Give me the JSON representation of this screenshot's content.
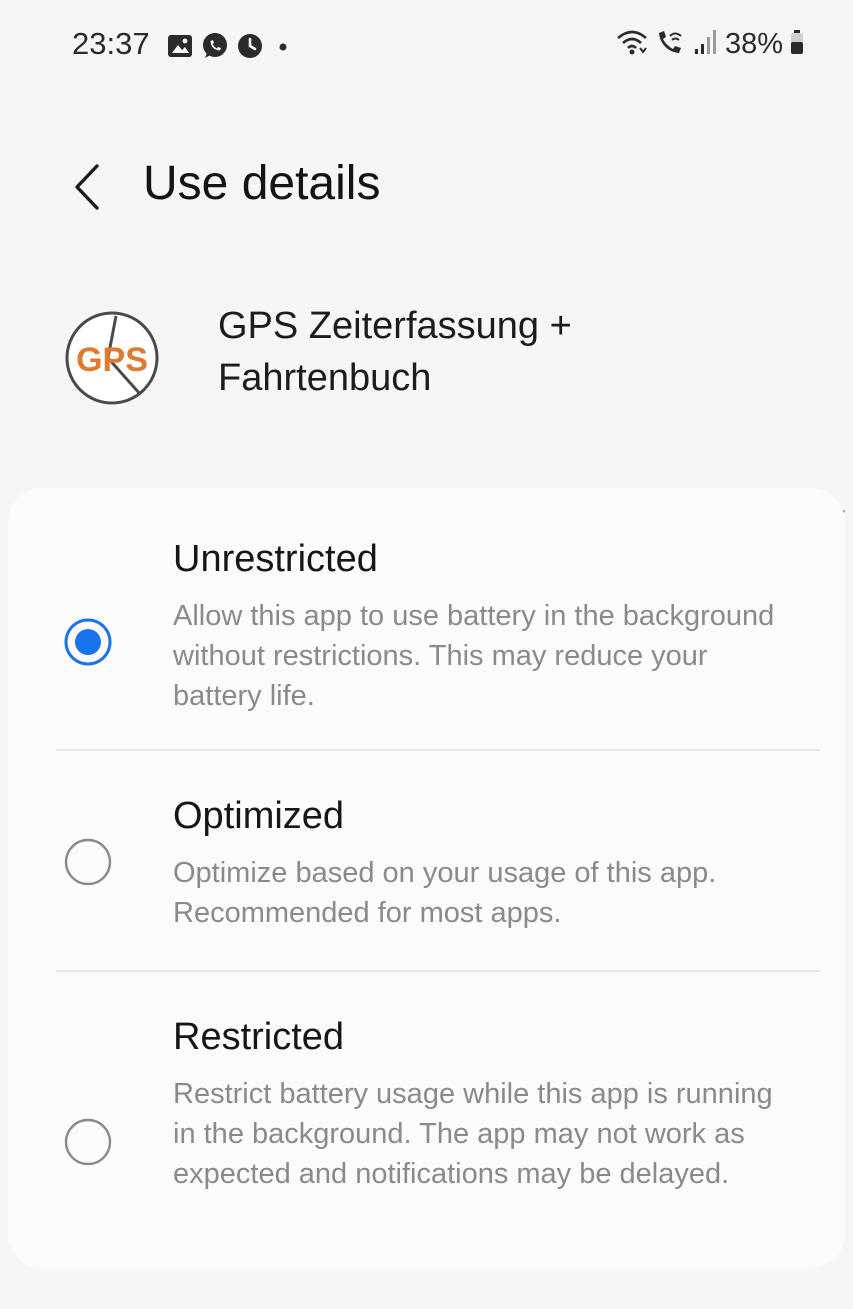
{
  "status_bar": {
    "time": "23:37",
    "battery": "38%",
    "left_icons": [
      "gallery-icon",
      "whatsapp-icon",
      "clock-icon",
      "dot-icon"
    ],
    "right_icons": [
      "wifi-icon",
      "wifi-call-icon",
      "signal-icon",
      "battery-icon"
    ]
  },
  "header": {
    "title": "Use details"
  },
  "app": {
    "name": "GPS Zeiterfassung + Fahrtenbuch",
    "icon_text": "GPS"
  },
  "options": [
    {
      "title": "Unrestricted",
      "description": "Allow this app to use battery in the background without restrictions. This may reduce your battery life.",
      "selected": true
    },
    {
      "title": "Optimized",
      "description": "Optimize based on your usage of this app. Recommended for most apps.",
      "selected": false
    },
    {
      "title": "Restricted",
      "description": "Restrict battery usage while this app is running in the background. The app may not work as expected and notifications may be delayed.",
      "selected": false
    }
  ],
  "colors": {
    "accent": "#1a73e8",
    "background": "#f6f6f6",
    "card": "#fbfbfb",
    "secondary_text": "#8a8a8a",
    "app_icon_orange": "#e07a2e"
  }
}
